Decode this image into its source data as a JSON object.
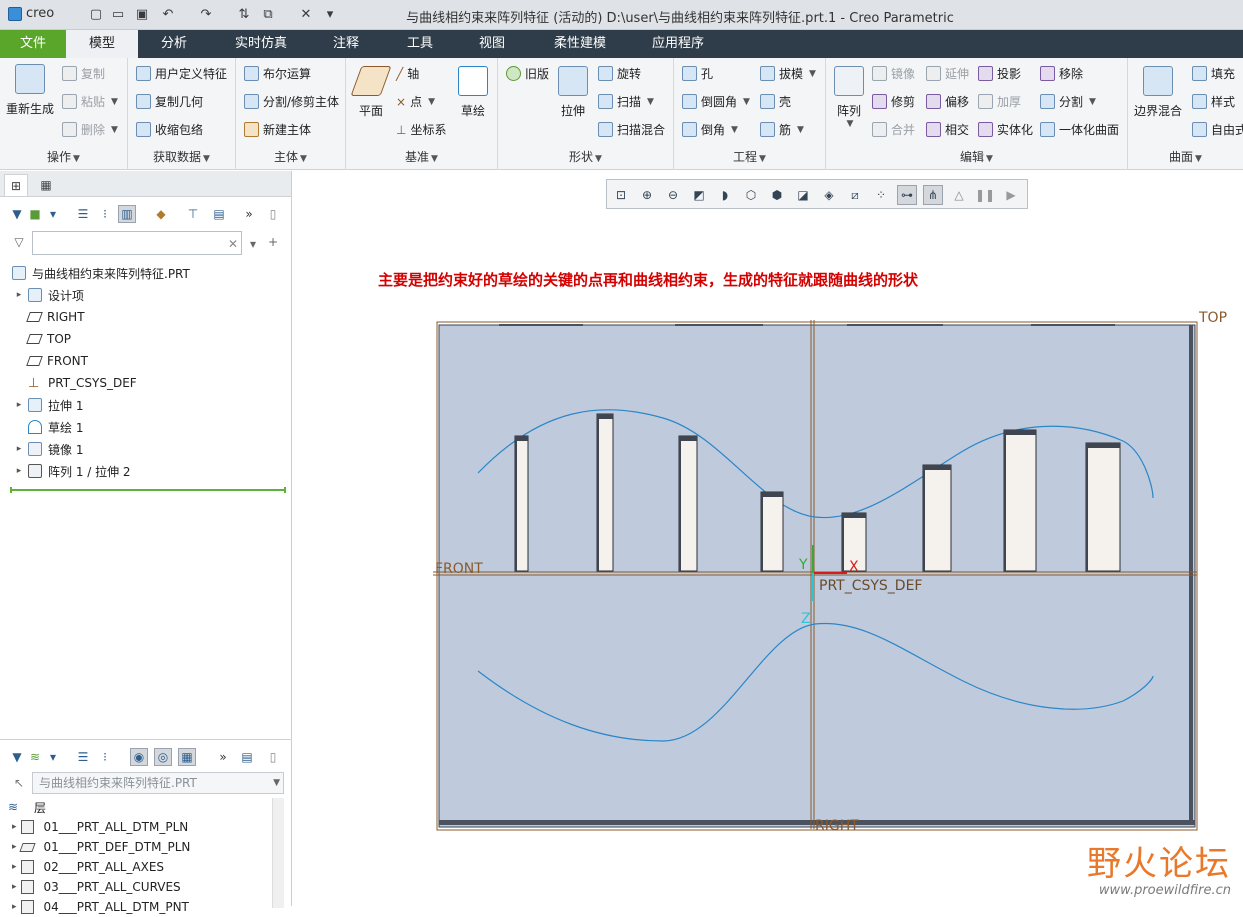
{
  "titlebar": {
    "logo": "creo",
    "title": "与曲线相约束来阵列特征 (活动的) D:\\user\\与曲线相约束来阵列特征.prt.1 - Creo Parametric"
  },
  "tabs": [
    "文件",
    "模型",
    "分析",
    "实时仿真",
    "注释",
    "工具",
    "视图",
    "柔性建模",
    "应用程序"
  ],
  "ribbon": {
    "groups": {
      "operations": "操作",
      "get_data": "获取数据",
      "body": "主体",
      "datum": "基准",
      "shapes": "形状",
      "engineering": "工程",
      "editing": "编辑",
      "surfaces": "曲面"
    },
    "buttons": {
      "regenerate": "重新生成",
      "copy": "复制",
      "paste": "粘贴",
      "delete": "删除",
      "udf": "用户定义特征",
      "copy_geom": "复制几何",
      "shrinkwrap": "收缩包络",
      "boolean": "布尔运算",
      "split_body": "分割/修剪主体",
      "new_body": "新建主体",
      "plane": "平面",
      "axis": "轴",
      "point": "点",
      "csys": "坐标系",
      "sketch": "草绘",
      "legacy": "旧版",
      "extrude": "拉伸",
      "revolve": "旋转",
      "sweep": "扫描",
      "swept_blend": "扫描混合",
      "hole": "孔",
      "round": "倒圆角",
      "chamfer": "倒角",
      "draft": "拔模",
      "shell": "壳",
      "rib": "筋",
      "pattern": "阵列",
      "mirror": "镜像",
      "trim": "修剪",
      "merge": "合并",
      "extend": "延伸",
      "offset": "偏移",
      "intersect": "相交",
      "project": "投影",
      "thicken": "加厚",
      "solidify": "实体化",
      "remove": "移除",
      "split": "分割",
      "unify_surface": "一体化曲面",
      "boundary_blend": "边界混合",
      "fill": "填充",
      "style": "样式",
      "freestyle": "自由式"
    }
  },
  "model_tree": {
    "filter_placeholder": "",
    "items": [
      {
        "label": "与曲线相约束来阵列特征.PRT",
        "icon": "part-icon"
      },
      {
        "label": "设计项",
        "icon": "design-items-icon"
      },
      {
        "label": "RIGHT",
        "icon": "datum-plane-icon"
      },
      {
        "label": "TOP",
        "icon": "datum-plane-icon"
      },
      {
        "label": "FRONT",
        "icon": "datum-plane-icon"
      },
      {
        "label": "PRT_CSYS_DEF",
        "icon": "csys-icon"
      },
      {
        "label": "拉伸 1",
        "icon": "extrude-icon"
      },
      {
        "label": "草绘 1",
        "icon": "sketch-icon"
      },
      {
        "label": "镜像 1",
        "icon": "mirror-icon"
      },
      {
        "label": "阵列 1 / 拉伸 2",
        "icon": "pattern-icon"
      }
    ]
  },
  "layer_tree": {
    "selector": "与曲线相约束来阵列特征.PRT",
    "header": "层",
    "items": [
      "01___PRT_ALL_DTM_PLN",
      "01___PRT_DEF_DTM_PLN",
      "02___PRT_ALL_AXES",
      "03___PRT_ALL_CURVES",
      "04___PRT_ALL_DTM_PNT"
    ]
  },
  "graphics": {
    "annotation": "主要是把约束好的草绘的关键的点再和曲线相约束，生成的特征就跟随曲线的形状",
    "datums": {
      "top": "TOP",
      "front": "FRONT",
      "right": "RIGHT",
      "csys": "PRT_CSYS_DEF",
      "x": "X",
      "y": "Y",
      "z": "Z"
    },
    "colors": {
      "background": "#ffffff",
      "plate": "#bfcbdc",
      "curve": "#2a86c8",
      "datum": "#8a5a2c",
      "annotation": "#d40000"
    }
  },
  "watermark": {
    "main": "野火论坛",
    "sub": "www.proewildfire.cn"
  }
}
